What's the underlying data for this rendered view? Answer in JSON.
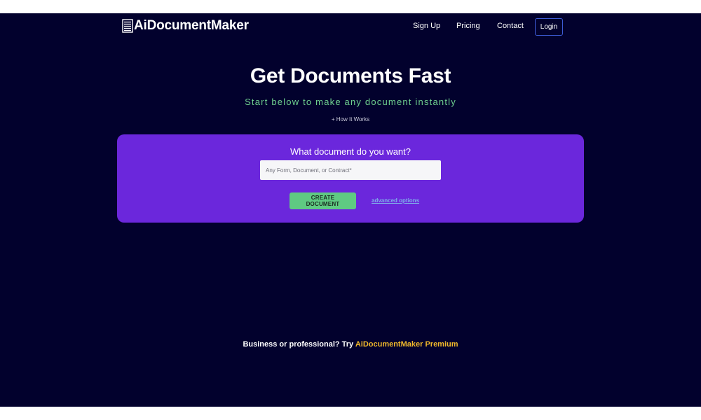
{
  "header": {
    "logo_text": "AiDocumentMaker",
    "logo_icon": "document-lines-icon",
    "nav": {
      "sign_up": "Sign Up",
      "pricing": "Pricing",
      "contact": "Contact",
      "login": "Login"
    }
  },
  "hero": {
    "title": "Get Documents Fast",
    "subtitle": "Start below to make any document instantly",
    "how_it_works": "+ How It Works"
  },
  "form": {
    "question": "What document do you want?",
    "input_value": "",
    "input_placeholder": "Any Form, Document, or Contract*",
    "create_button": "CREATE DOCUMENT",
    "advanced_options": "advanced options"
  },
  "footer": {
    "premium_prefix": "Business or professional? Try ",
    "premium_link": "AiDocumentMaker Premium"
  },
  "colors": {
    "background": "#02012d",
    "panel": "#6b27dc",
    "accent_green": "#5fca82",
    "subtitle_green": "#6fd08f",
    "premium_gold": "#f1b92b",
    "login_border": "#3e5bd8"
  }
}
